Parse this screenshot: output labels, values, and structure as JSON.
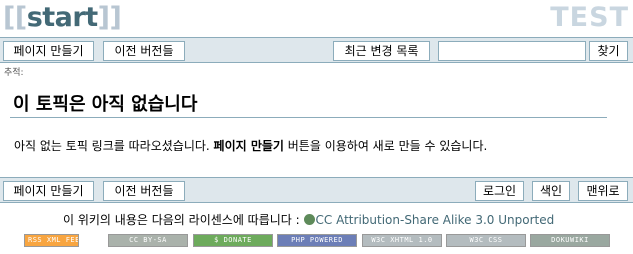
{
  "header": {
    "logo_open": "[[",
    "logo_word": "start",
    "logo_close": "]]",
    "site_name": "TEST"
  },
  "toolbar_top": {
    "create_page": "페이지 만들기",
    "old_revisions": "이전 버전들",
    "recent_changes": "최근 변경 목록",
    "search_value": "",
    "search_button": "찾기"
  },
  "breadcrumb": {
    "label": "추적:"
  },
  "content": {
    "title": "이 토픽은 아직 없습니다",
    "text_before": "아직 없는 토픽 링크를 따라오셨습니다. ",
    "text_bold": "페이지 만들기",
    "text_after": " 버튼을 이용하여 새로 만들 수 있습니다."
  },
  "toolbar_bottom": {
    "create_page": "페이지 만들기",
    "old_revisions": "이전 버전들",
    "login": "로그인",
    "index": "색인",
    "to_top": "맨위로"
  },
  "footer": {
    "license_text": "이 위키의 내용은 다음의 라이센스에 따릅니다 :",
    "license_link": "CC Attribution-Share Alike 3.0 Unported",
    "badges": [
      {
        "label": "RSS XML FEED",
        "color": "#f8a540"
      },
      {
        "label": "CC BY-SA",
        "color": "#aab2ab"
      },
      {
        "label": "$ DONATE",
        "color": "#6dab5c"
      },
      {
        "label": "PHP POWERED",
        "color": "#6c7eb7"
      },
      {
        "label": "W3C XHTML 1.0",
        "color": "#b4bcbf"
      },
      {
        "label": "W3C CSS",
        "color": "#b4bcbf"
      },
      {
        "label": "DOKUWIKI",
        "color": "#9aa8a0"
      }
    ]
  }
}
